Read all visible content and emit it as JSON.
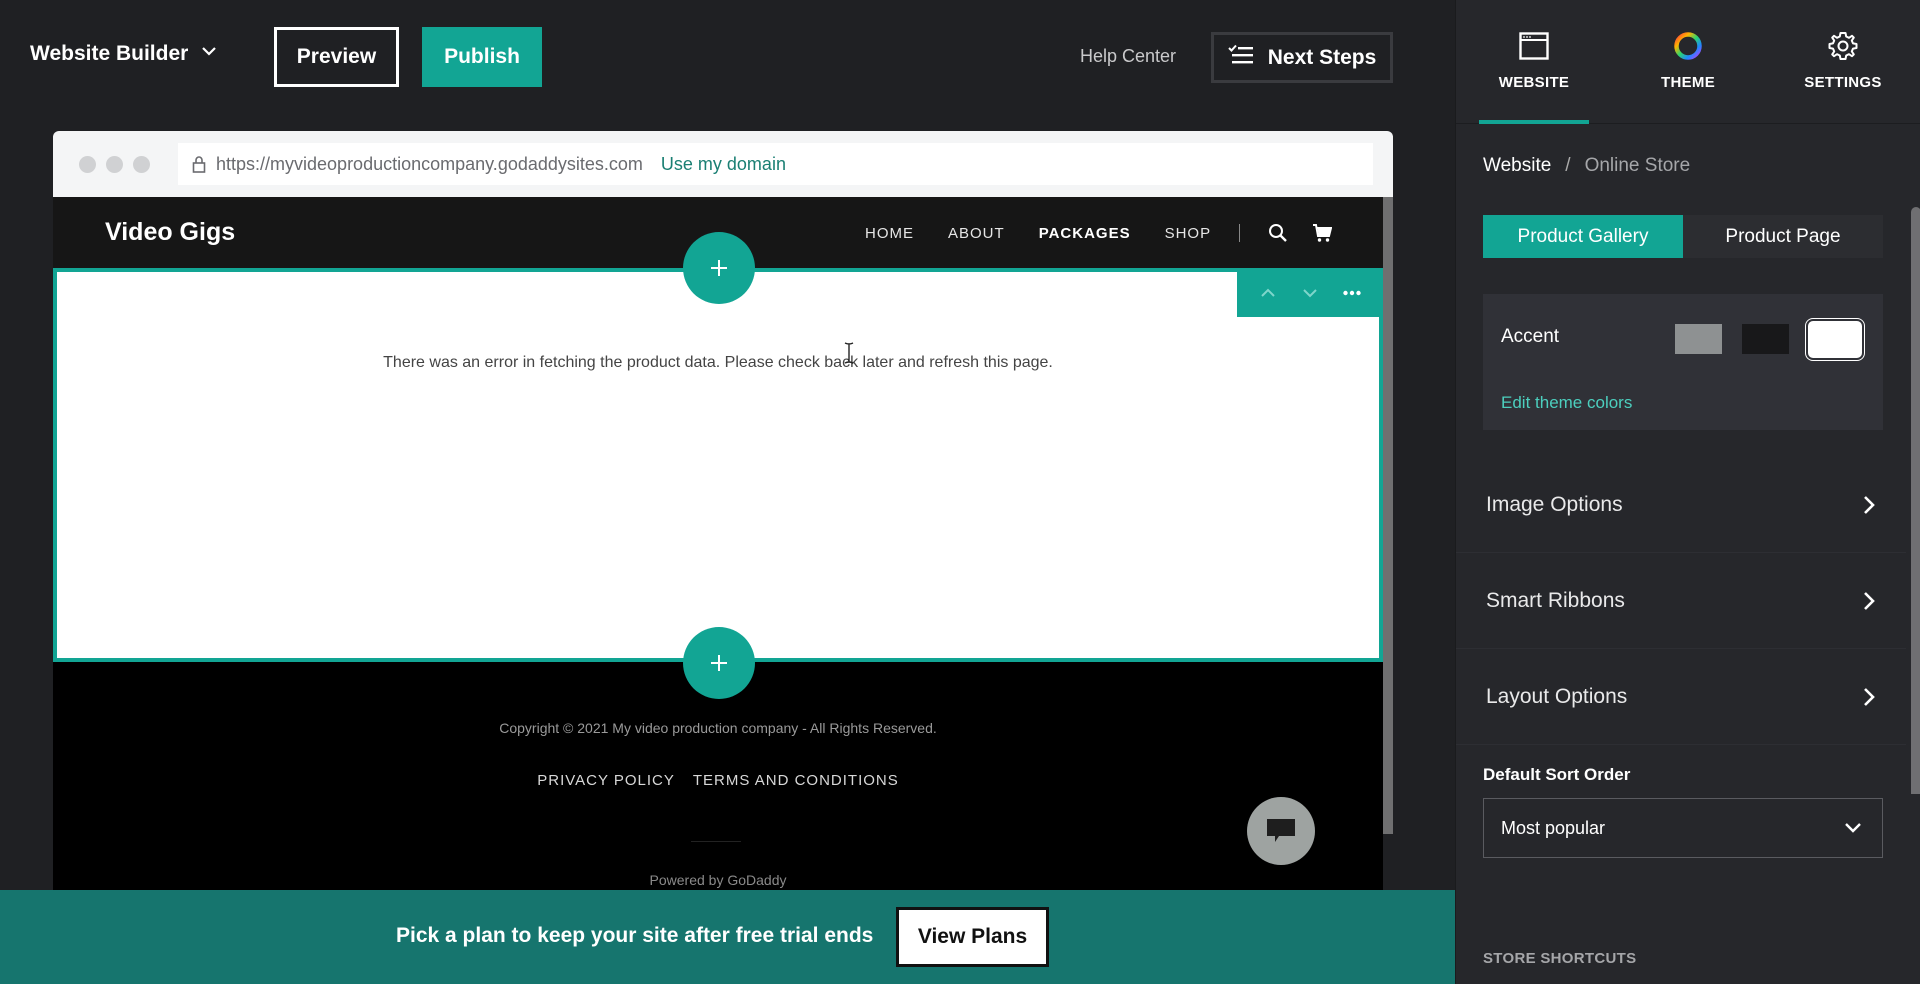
{
  "topbar": {
    "brand": "Website Builder",
    "preview": "Preview",
    "publish": "Publish",
    "help_center": "Help Center",
    "next_steps": "Next Steps"
  },
  "browser": {
    "url": "https://myvideoproductioncompany.godaddysites.com",
    "use_domain": "Use my domain"
  },
  "site": {
    "logo": "Video Gigs",
    "nav": [
      "HOME",
      "ABOUT",
      "PACKAGES",
      "SHOP"
    ],
    "active_nav": "PACKAGES",
    "error_message": "There was an error in fetching the product data. Please check back later and refresh this page.",
    "footer": {
      "copyright": "Copyright © 2021 My video production company - All Rights Reserved.",
      "links": [
        "PRIVACY POLICY",
        "TERMS AND CONDITIONS"
      ],
      "powered_by": "Powered by GoDaddy"
    }
  },
  "banner": {
    "text": "Pick a plan to keep your site after free trial ends",
    "button": "View Plans"
  },
  "panel": {
    "tabs": [
      {
        "label": "WEBSITE",
        "icon": "browser-window-icon",
        "active": true
      },
      {
        "label": "THEME",
        "icon": "color-wheel-icon",
        "active": false
      },
      {
        "label": "SETTINGS",
        "icon": "gear-icon",
        "active": false
      }
    ],
    "breadcrumb": {
      "root": "Website",
      "separator": "/",
      "current": "Online Store"
    },
    "segments": [
      {
        "label": "Product Gallery",
        "active": true
      },
      {
        "label": "Product Page",
        "active": false
      }
    ],
    "accent": {
      "label": "Accent",
      "swatches": [
        {
          "color": "#8e9192",
          "selected": false
        },
        {
          "color": "#18181a",
          "selected": false
        },
        {
          "color": "#ffffff",
          "selected": true
        }
      ],
      "edit_link": "Edit theme colors"
    },
    "options": [
      "Image Options",
      "Smart Ribbons",
      "Layout Options"
    ],
    "sort": {
      "label": "Default Sort Order",
      "value": "Most popular"
    },
    "store_shortcuts": "STORE SHORTCUTS"
  },
  "colors": {
    "brand_teal": "#12a594",
    "banner_teal": "#16756e",
    "link_teal": "#4ccfbe",
    "app_bg": "#1f2023",
    "panel_bg": "#26272b"
  }
}
